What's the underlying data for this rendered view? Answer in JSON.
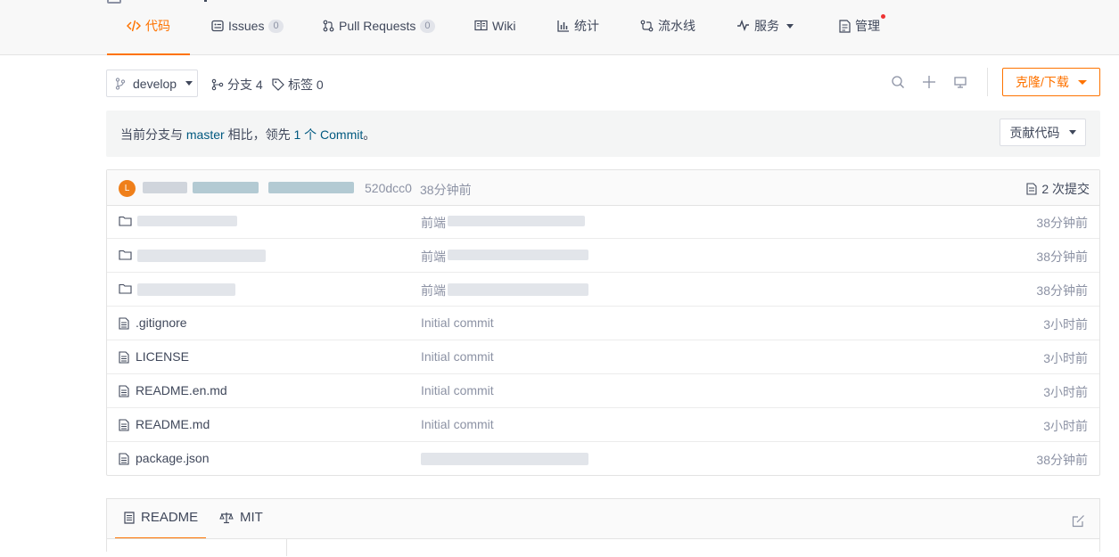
{
  "nav": {
    "tabs": [
      {
        "label": "代码",
        "icon": "code-icon"
      },
      {
        "label": "Issues",
        "count": "0",
        "icon": "issues-icon"
      },
      {
        "label": "Pull Requests",
        "count": "0",
        "icon": "pull-request-icon"
      },
      {
        "label": "Wiki",
        "icon": "wiki-book-icon"
      },
      {
        "label": "统计",
        "icon": "stats-chart-icon"
      },
      {
        "label": "流水线",
        "icon": "pipeline-icon"
      },
      {
        "label": "服务",
        "icon": "service-pulse-icon"
      },
      {
        "label": "管理",
        "icon": "manage-doc-icon"
      }
    ],
    "active_tab": "代码",
    "accent_color": "#fe7300"
  },
  "toolbar": {
    "branch": "develop",
    "branches_label": "分支 4",
    "tags_label": "标签 0",
    "clone_label": "克隆/下载"
  },
  "notice": {
    "prefix": "当前分支与",
    "base_branch": "master",
    "middle": "相比，领先",
    "ahead": "1 个 Commit",
    "suffix": "。",
    "contribute_label": "贡献代码"
  },
  "last_commit": {
    "avatar_letter": "L",
    "sha": "520dcc0",
    "time": "38分钟前",
    "commits_count_label": "2 次提交"
  },
  "files": [
    {
      "type": "folder",
      "name": "",
      "message": "前端",
      "time": "38分钟前"
    },
    {
      "type": "folder",
      "name": "",
      "message": "前端",
      "time": "38分钟前"
    },
    {
      "type": "folder",
      "name": "",
      "message": "前端",
      "time": "38分钟前"
    },
    {
      "type": "file",
      "name": ".gitignore",
      "message": "Initial commit",
      "time": "3小时前"
    },
    {
      "type": "file",
      "name": "LICENSE",
      "message": "Initial commit",
      "time": "3小时前"
    },
    {
      "type": "file",
      "name": "README.en.md",
      "message": "Initial commit",
      "time": "3小时前"
    },
    {
      "type": "file",
      "name": "README.md",
      "message": "Initial commit",
      "time": "3小时前"
    },
    {
      "type": "file",
      "name": "package.json",
      "message": "",
      "time": "38分钟前"
    }
  ],
  "readme": {
    "tabs": [
      {
        "label": "README",
        "icon": "readme-doc-icon"
      },
      {
        "label": "MIT",
        "icon": "license-scale-icon"
      }
    ]
  }
}
